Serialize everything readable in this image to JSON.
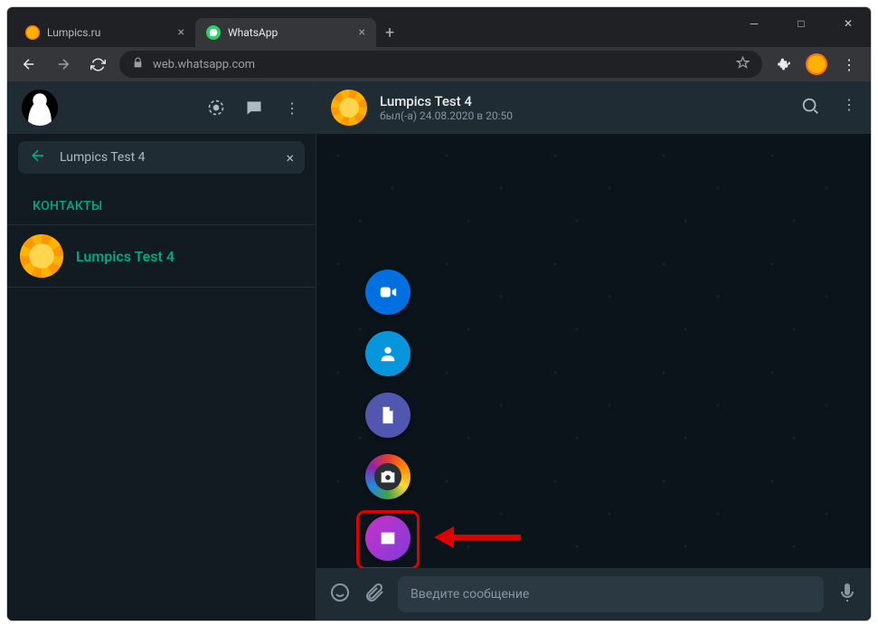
{
  "browser": {
    "tabs": [
      {
        "title": "Lumpics.ru",
        "active": false
      },
      {
        "title": "WhatsApp",
        "active": true
      }
    ],
    "url": "web.whatsapp.com"
  },
  "sidebar": {
    "search_value": "Lumpics Test 4",
    "section_label": "КОНТАКТЫ",
    "contact": {
      "name": "Lumpics Test 4"
    }
  },
  "chat": {
    "title": "Lumpics Test 4",
    "subtitle": "был(-а) 24.08.2020 в 20:50",
    "attach_options": {
      "room": "room-icon",
      "contact": "contact-icon",
      "document": "document-icon",
      "camera": "camera-icon",
      "gallery": "gallery-icon"
    },
    "input_placeholder": "Введите сообщение"
  }
}
